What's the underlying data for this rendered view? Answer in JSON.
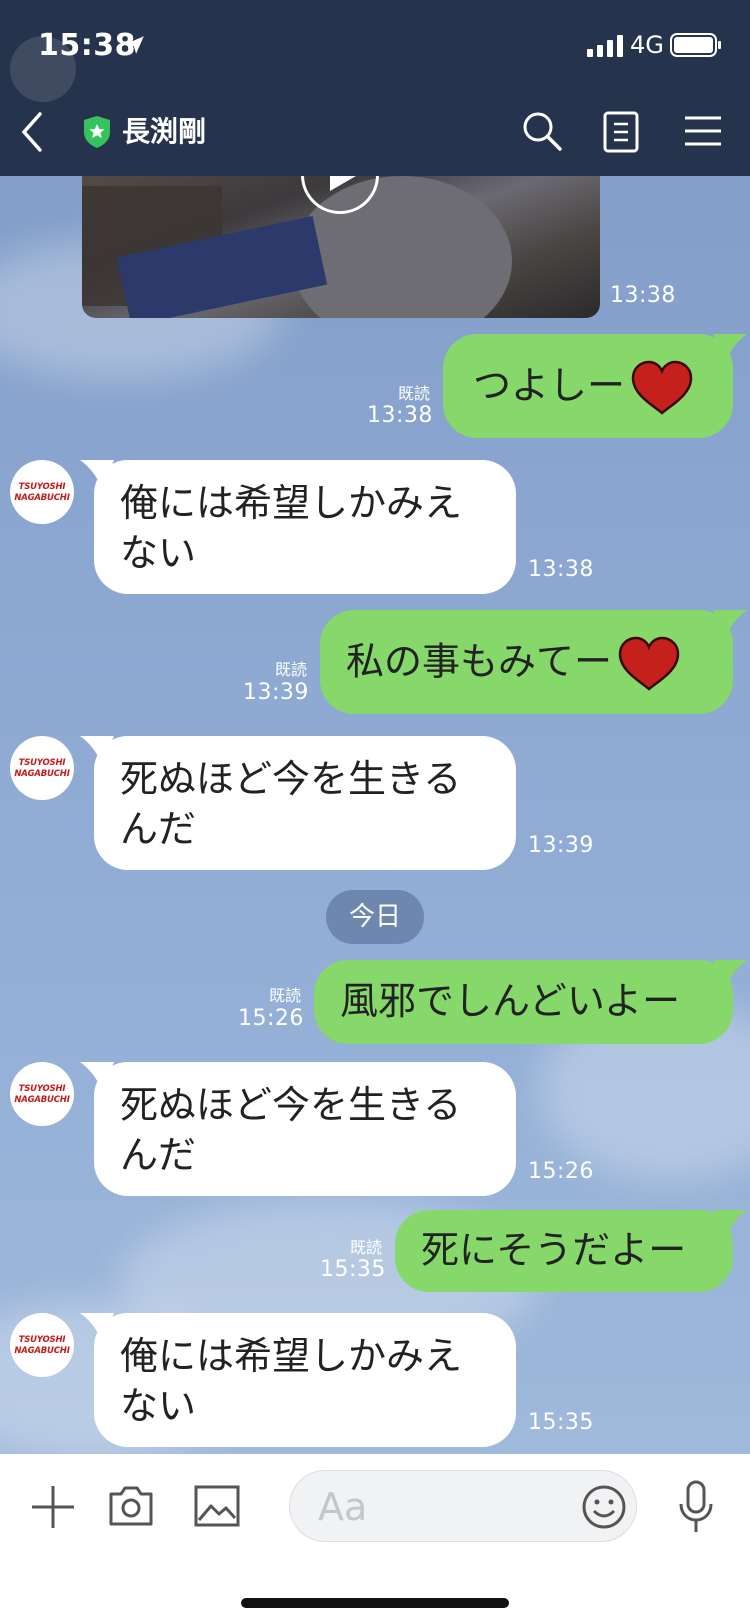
{
  "status_bar": {
    "time": "15:38",
    "network": "4G"
  },
  "header": {
    "title": "長渕剛"
  },
  "avatar_text": {
    "line1": "TSUYOSHI",
    "line2": "NAGABUCHI"
  },
  "video_message": {
    "time": "13:38"
  },
  "messages": [
    {
      "side": "mine",
      "text": "つよしー",
      "heart": true,
      "read": "既読",
      "time": "13:38"
    },
    {
      "side": "theirs",
      "line1": "俺には希望しかみえ",
      "line2": "ない",
      "time": "13:38"
    },
    {
      "side": "mine",
      "text": "私の事もみてー",
      "heart": true,
      "read": "既読",
      "time": "13:39"
    },
    {
      "side": "theirs",
      "line1": "死ぬほど今を生きる",
      "line2": "んだ",
      "time": "13:39"
    },
    {
      "side": "mine",
      "text": "風邪でしんどいよー",
      "heart": false,
      "read": "既読",
      "time": "15:26"
    },
    {
      "side": "theirs",
      "line1": "死ぬほど今を生きる",
      "line2": "んだ",
      "time": "15:26"
    },
    {
      "side": "mine",
      "text": "死にそうだよー",
      "heart": false,
      "read": "既読",
      "time": "15:35"
    },
    {
      "side": "theirs",
      "line1": "俺には希望しかみえ",
      "line2": "ない",
      "time": "15:35"
    }
  ],
  "date_separator": "今日",
  "input": {
    "placeholder": "Aa"
  },
  "colors": {
    "header_bg": "#26334d",
    "mine_bubble": "#86d86a",
    "theirs_bubble": "#ffffff",
    "heart": "#c4201c"
  }
}
